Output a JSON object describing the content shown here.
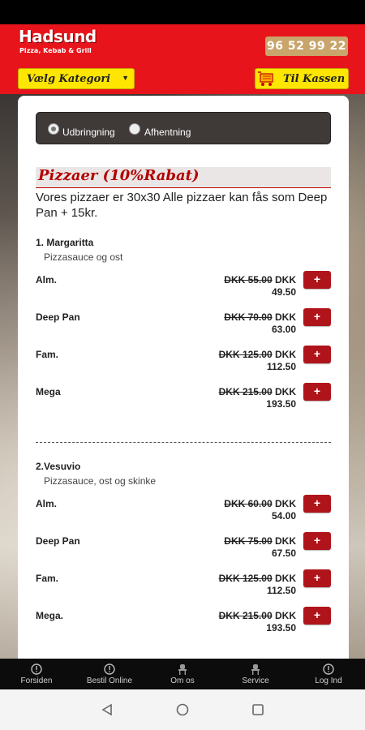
{
  "header": {
    "brand_name": "Hadsund",
    "brand_sub": "Pizza, Kebab & Grill",
    "phone": "96 52 99 22",
    "category_label": "Vælg Kategori",
    "checkout_label": "Til Kassen"
  },
  "order_type": {
    "delivery_label": "Udbringning",
    "pickup_label": "Afhentning",
    "selected": "Udbringning"
  },
  "section": {
    "title": "Pizzaer (10%Rabat)",
    "description": "Vores pizzaer er 30x30 Alle pizzaer kan fås som Deep Pan + 15kr."
  },
  "products": [
    {
      "name": "1. Margaritta",
      "description": "Pizzasauce og ost",
      "variants": [
        {
          "name": "Alm.",
          "old_price": "DKK 55.00",
          "new_price": "DKK 49.50",
          "add": "+"
        },
        {
          "name": "Deep Pan",
          "old_price": "DKK 70.00",
          "new_price": "DKK 63.00",
          "add": "+"
        },
        {
          "name": "Fam.",
          "old_price": "DKK 125.00",
          "new_price": "DKK 112.50",
          "add": "+"
        },
        {
          "name": "Mega",
          "old_price": "DKK 215.00",
          "new_price": "DKK 193.50",
          "add": "+"
        }
      ]
    },
    {
      "name": "2.Vesuvio",
      "description": "Pizzasauce, ost og skinke",
      "variants": [
        {
          "name": "Alm.",
          "old_price": "DKK 60.00",
          "new_price": "DKK 54.00",
          "add": "+"
        },
        {
          "name": "Deep Pan",
          "old_price": "DKK 75.00",
          "new_price": "DKK 67.50",
          "add": "+"
        },
        {
          "name": "Fam.",
          "old_price": "DKK 125.00",
          "new_price": "DKK 112.50",
          "add": "+"
        },
        {
          "name": "Mega.",
          "old_price": "DKK 215.00",
          "new_price": "DKK 193.50",
          "add": "+"
        }
      ]
    }
  ],
  "bottom_nav": [
    {
      "label": "Forsiden",
      "icon": "info-circle-icon"
    },
    {
      "label": "Bestil Online",
      "icon": "info-circle-icon"
    },
    {
      "label": "Om os",
      "icon": "chair-icon"
    },
    {
      "label": "Service",
      "icon": "chair-icon"
    },
    {
      "label": "Log Ind",
      "icon": "info-circle-icon"
    }
  ],
  "colors": {
    "brand_red": "#e8141b",
    "accent_yellow": "#ffe600",
    "button_red": "#b0141b",
    "phone_badge": "#c9a56b"
  }
}
